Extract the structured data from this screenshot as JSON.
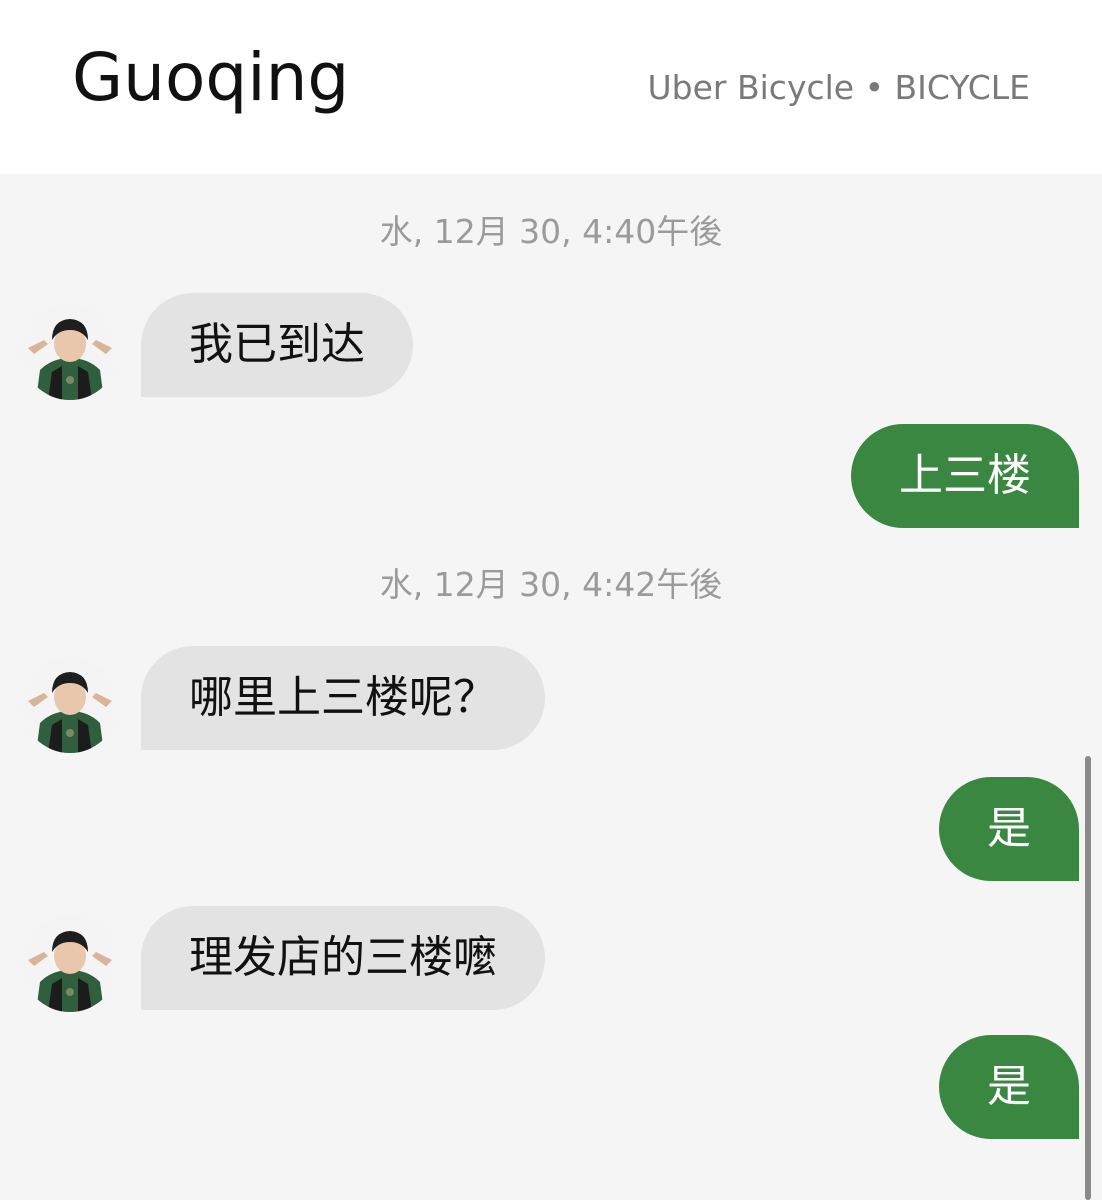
{
  "header": {
    "contact_name": "Guoqing",
    "vehicle_info": "Uber Bicycle • BICYCLE"
  },
  "conversation": {
    "timestamps": [
      "水, 12月 30, 4:40午後",
      "水, 12月 30, 4:42午後"
    ],
    "messages": [
      {
        "direction": "incoming",
        "text": "我已到达"
      },
      {
        "direction": "outgoing",
        "text": "上三楼"
      },
      {
        "direction": "incoming",
        "text": "哪里上三楼呢？"
      },
      {
        "direction": "outgoing",
        "text": "是"
      },
      {
        "direction": "incoming",
        "text": "理发店的三楼嚒"
      },
      {
        "direction": "outgoing",
        "text": "是"
      }
    ]
  },
  "colors": {
    "outgoing_bubble": "#3a8741",
    "incoming_bubble": "#e3e3e3",
    "chat_background": "#f5f5f5",
    "timestamp_text": "#9b9b9b"
  },
  "icons": {
    "avatar": "driver-avatar-photo"
  }
}
